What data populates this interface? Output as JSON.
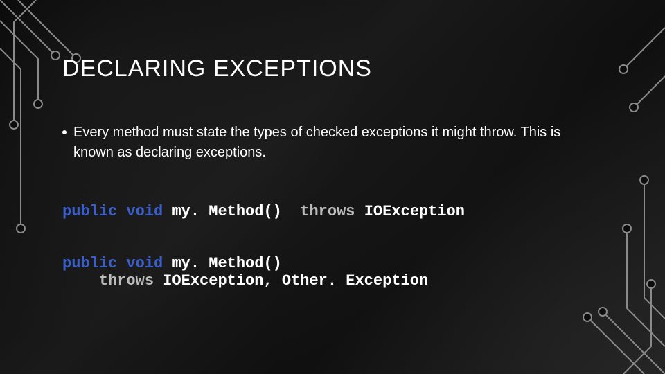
{
  "title": "DECLARING EXCEPTIONS",
  "bullet": "Every method must state the types of checked exceptions it might throw. This is known as declaring exceptions.",
  "code1": {
    "kw1": "public",
    "kw2": "void",
    "name": "my. Method()",
    "thr": "throws",
    "ex": "IOException"
  },
  "code2": {
    "kw1": "public",
    "kw2": "void",
    "name": "my. Method()",
    "indent": "    ",
    "thr": "throws",
    "ex": "IOException, Other. Exception"
  },
  "decor": {
    "stroke": "#8a8a8a",
    "node_fill": "#0c0c0c"
  }
}
